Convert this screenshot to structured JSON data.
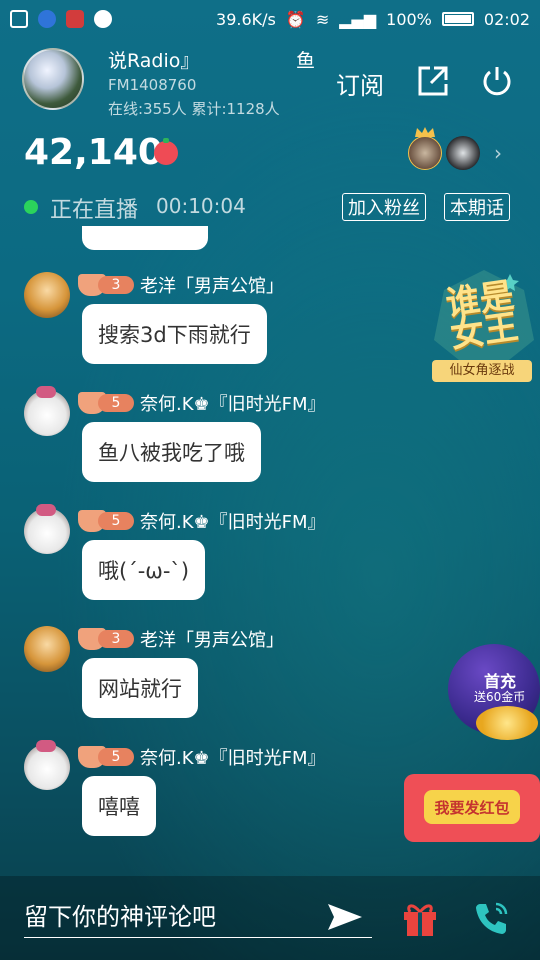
{
  "status_bar": {
    "net_speed": "39.6K/s",
    "battery": "100%",
    "time": "02:02"
  },
  "header": {
    "host_name": "说Radio』",
    "host_name_tail": "鱼",
    "fm_id": "FM1408760",
    "online": "在线:355人  累计:1128人",
    "subscribe": "订阅"
  },
  "stats": {
    "score": "42,140"
  },
  "live": {
    "status": "正在直播",
    "elapsed": "00:10:04",
    "join_fans": "加入粉丝",
    "this_topic": "本期话"
  },
  "messages": [
    {
      "level": "3",
      "user": "老洋「男声公馆」",
      "text": "搜索3d下雨就行",
      "avatar": "cat-gold"
    },
    {
      "level": "5",
      "user": "奈何.K♚『旧时光FM』",
      "text": "鱼八被我吃了哦",
      "avatar": "cat-white"
    },
    {
      "level": "5",
      "user": "奈何.K♚『旧时光FM』",
      "text": "哦(´-ω-`)",
      "avatar": "cat-white"
    },
    {
      "level": "3",
      "user": "老洋「男声公馆」",
      "text": "网站就行",
      "avatar": "cat-gold"
    },
    {
      "level": "5",
      "user": "奈何.K♚『旧时光FM』",
      "text": "嘻嘻",
      "avatar": "cat-white"
    }
  ],
  "promos": {
    "queen_title": "谁是女王",
    "queen_sub": "仙女角逐战",
    "first_charge_title": "首充",
    "first_charge_sub": "送60金币",
    "red_packet": "我要发红包"
  },
  "bottom": {
    "comment_placeholder": "留下你的神评论吧"
  },
  "colors": {
    "accent_live": "#2bd35c",
    "level_badge": "#e7825f",
    "red_packet": "#ef4f56",
    "gift": "#e9443e",
    "phone": "#2ec4c0"
  }
}
